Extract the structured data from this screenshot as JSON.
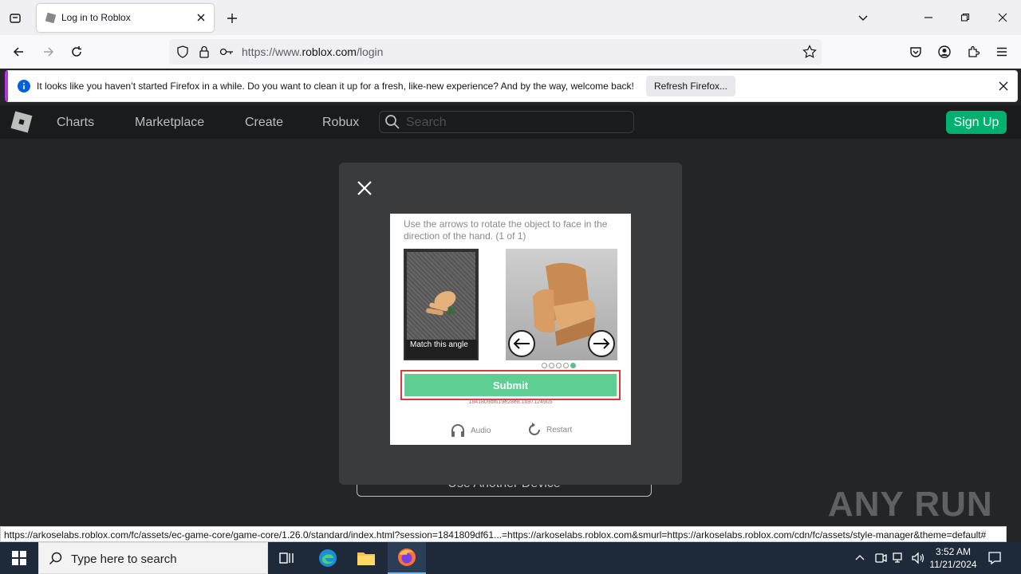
{
  "browser": {
    "tab_title": "Log in to Roblox",
    "url_prefix": "https://www.",
    "url_domain": "roblox.com",
    "url_path": "/login",
    "notification_message": "It looks like you haven’t started Firefox in a while. Do you want to clean it up for a fresh, like-new experience? And by the way, welcome back!",
    "notification_button": "Refresh Firefox...",
    "status_url": "https://arkoselabs.roblox.com/fc/assets/ec-game-core/game-core/1.26.0/standard/index.html?session=1841809df61...=https://arkoselabs.roblox.com&smurl=https://arkoselabs.roblox.com/cdn/fc/assets/style-manager&theme=default#"
  },
  "roblox": {
    "nav": [
      "Charts",
      "Marketplace",
      "Create",
      "Robux"
    ],
    "search_placeholder": "Search",
    "signup_label": "Sign Up",
    "another_device_label": "Use Another Device"
  },
  "captcha": {
    "instruction": "Use the arrows to rotate the object to face in the direction of the hand. (1 of 1)",
    "reference_label": "Match this angle",
    "submit_label": "Submit",
    "session_id": "1841809df619e28e8.1697124905",
    "audio_label": "Audio",
    "restart_label": "Restart",
    "progress": {
      "total": 5,
      "current": 5
    },
    "accent_color": "#5fce92"
  },
  "taskbar": {
    "search_placeholder": "Type here to search",
    "time": "3:52 AM",
    "date": "11/21/2024"
  },
  "watermark": "ANY RUN"
}
